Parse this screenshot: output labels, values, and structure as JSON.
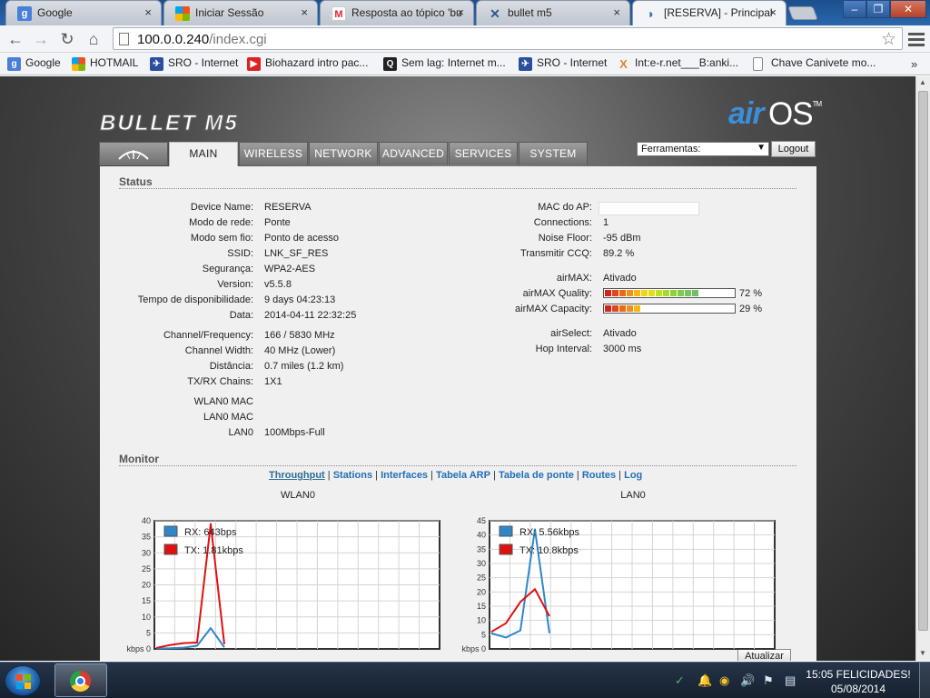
{
  "browser": {
    "tabs": [
      {
        "title": "Google",
        "icon": "google-icon",
        "color": "#4a7fd8",
        "glyph": "g"
      },
      {
        "title": "Iniciar Sessão",
        "icon": "windows-icon",
        "color": "#e85a2a",
        "glyph": ""
      },
      {
        "title": "Resposta ao tópico 'bu",
        "icon": "gmail-icon",
        "color": "#ffffff",
        "glyph": "M"
      },
      {
        "title": "bullet m5",
        "icon": "ubnt-icon",
        "color": "#2d2d2d",
        "glyph": "✕"
      },
      {
        "title": "[RESERVA] - Principal",
        "icon": "wifi-icon",
        "color": "#2c6fb4",
        "glyph": "≋"
      }
    ],
    "tab_close": "×",
    "url": {
      "host": "100.0.0.240",
      "path": "/index.cgi"
    },
    "bookmarks": [
      {
        "label": "Google",
        "icon": "google-icon",
        "color": "#4a7fd8",
        "glyph": "g"
      },
      {
        "label": "HOTMAIL",
        "icon": "windows-icon",
        "color": "#e85a2a",
        "glyph": ""
      },
      {
        "label": "SRO - Internet",
        "icon": "correios-icon",
        "color": "#2a4f9e",
        "glyph": "✈"
      },
      {
        "label": "Biohazard intro pac...",
        "icon": "youtube-icon",
        "color": "#d22",
        "glyph": "▶"
      },
      {
        "label": "Sem lag: Internet m...",
        "icon": "qr-icon",
        "color": "#222",
        "glyph": "Q"
      },
      {
        "label": "SRO - Internet",
        "icon": "correios-icon",
        "color": "#2a4f9e",
        "glyph": "✈"
      },
      {
        "label": "Int:e-r.net___B:anki...",
        "icon": "x-icon",
        "color": "#e0861f",
        "glyph": "X"
      },
      {
        "label": "Chave Canivete mo...",
        "icon": "page-icon",
        "color": "#ffffff",
        "glyph": ""
      }
    ],
    "bookmarks_more": "»"
  },
  "airos": {
    "product_logo": "BULLET M5",
    "brand_air": "air",
    "brand_os": "OS",
    "brand_tm": "TM",
    "nav_tabs": [
      "MAIN",
      "WIRELESS",
      "NETWORK",
      "ADVANCED",
      "SERVICES",
      "SYSTEM"
    ],
    "tools_label": "Ferramentas:",
    "logout_label": "Logout",
    "status_title": "Status",
    "left": [
      {
        "label": "Device Name:",
        "value": "RESERVA"
      },
      {
        "label": "Modo de rede:",
        "value": "Ponte"
      },
      {
        "label": "Modo sem fio:",
        "value": "Ponto de acesso"
      },
      {
        "label": "SSID:",
        "value": "LNK_SF_RES"
      },
      {
        "label": "Segurança:",
        "value": "WPA2-AES"
      },
      {
        "label": "Version:",
        "value": "v5.5.8"
      },
      {
        "label": "Tempo de disponibilidade:",
        "value": "9 days 04:23:13"
      },
      {
        "label": "Data:",
        "value": "2014-04-11 22:32:25"
      },
      {
        "label": "Channel/Frequency:",
        "value": "166 / 5830 MHz"
      },
      {
        "label": "Channel Width:",
        "value": "40 MHz (Lower)"
      },
      {
        "label": "Distância:",
        "value": "0.7 miles (1.2 km)"
      },
      {
        "label": "TX/RX Chains:",
        "value": "1X1"
      },
      {
        "label": "WLAN0 MAC",
        "value": ""
      },
      {
        "label": "LAN0 MAC",
        "value": ""
      },
      {
        "label": "LAN0",
        "value": "100Mbps-Full"
      }
    ],
    "right": [
      {
        "label": "MAC do AP:",
        "value": ""
      },
      {
        "label": "Connections:",
        "value": "1"
      },
      {
        "label": "Noise Floor:",
        "value": "-95 dBm"
      },
      {
        "label": "Transmitir CCQ:",
        "value": "89.2 %"
      },
      {
        "label": "airMAX:",
        "value": "Ativado"
      },
      {
        "label": "airMAX Quality:",
        "value": "72 %"
      },
      {
        "label": "airMAX Capacity:",
        "value": "29 %"
      },
      {
        "label": "airSelect:",
        "value": "Ativado"
      },
      {
        "label": "Hop Interval:",
        "value": "3000 ms"
      }
    ],
    "airmax_quality_level": 0.72,
    "airmax_capacity_level": 0.29,
    "monitor_title": "Monitor",
    "monitor_links": [
      "Throughput",
      "Stations",
      "Interfaces",
      "Tabela ARP",
      "Tabela de ponte",
      "Routes",
      "Log"
    ],
    "monitor_selected": "Throughput",
    "monitor_sep": "|",
    "refresh_label": "Atualizar",
    "colors": {
      "rx": "#2f87c8",
      "tx": "#e01010"
    }
  },
  "chart_data": [
    {
      "type": "line",
      "title": "WLAN0",
      "ylabel": "kbps",
      "ylim": [
        0,
        40
      ],
      "yticks": [
        5,
        10,
        15,
        20,
        25,
        30,
        35,
        40
      ],
      "grid": true,
      "legend": "top-left",
      "series": [
        {
          "name": "RX: 643bps",
          "values": [
            0.1,
            0.2,
            0.4,
            1.0,
            6.5,
            0.5
          ]
        },
        {
          "name": "TX: 1.81kbps",
          "values": [
            0.3,
            1.2,
            1.8,
            2.0,
            39.0,
            1.5
          ]
        }
      ]
    },
    {
      "type": "line",
      "title": "LAN0",
      "ylabel": "kbps",
      "ylim": [
        0,
        45
      ],
      "yticks": [
        5,
        10,
        15,
        20,
        25,
        30,
        35,
        40,
        45
      ],
      "grid": true,
      "legend": "top-left",
      "series": [
        {
          "name": "RX: 5.56kbps",
          "values": [
            5.5,
            4.0,
            6.5,
            42.0,
            5.5
          ]
        },
        {
          "name": "TX: 10.8kbps",
          "values": [
            6.0,
            9.0,
            16.5,
            21.0,
            11.5
          ]
        }
      ]
    }
  ],
  "taskbar": {
    "clock_time": "15:05 FELICIDADES!",
    "clock_date": "05/08/2014"
  }
}
